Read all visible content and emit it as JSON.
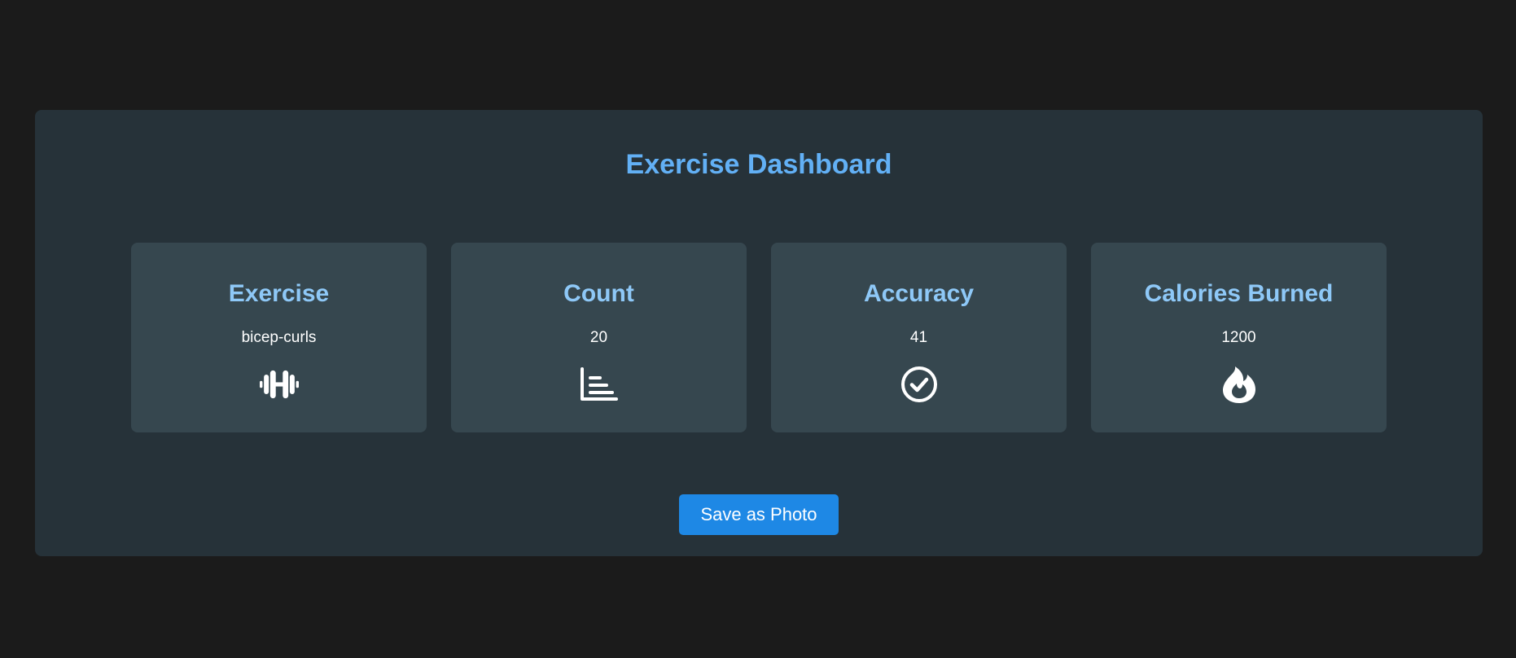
{
  "dashboard": {
    "title": "Exercise Dashboard"
  },
  "cards": [
    {
      "title": "Exercise",
      "value": "bicep-curls",
      "icon": "dumbbell-icon"
    },
    {
      "title": "Count",
      "value": "20",
      "icon": "bar-chart-icon"
    },
    {
      "title": "Accuracy",
      "value": "41",
      "icon": "check-circle-icon"
    },
    {
      "title": "Calories Burned",
      "value": "1200",
      "icon": "fire-icon"
    }
  ],
  "actions": {
    "save_label": "Save as Photo"
  },
  "colors": {
    "page_background": "#1b1b1b",
    "panel_background": "#263239",
    "card_background": "#36474f",
    "title_accent": "#62b0f5",
    "card_title": "#8ec8f7",
    "button": "#1e88e5"
  }
}
